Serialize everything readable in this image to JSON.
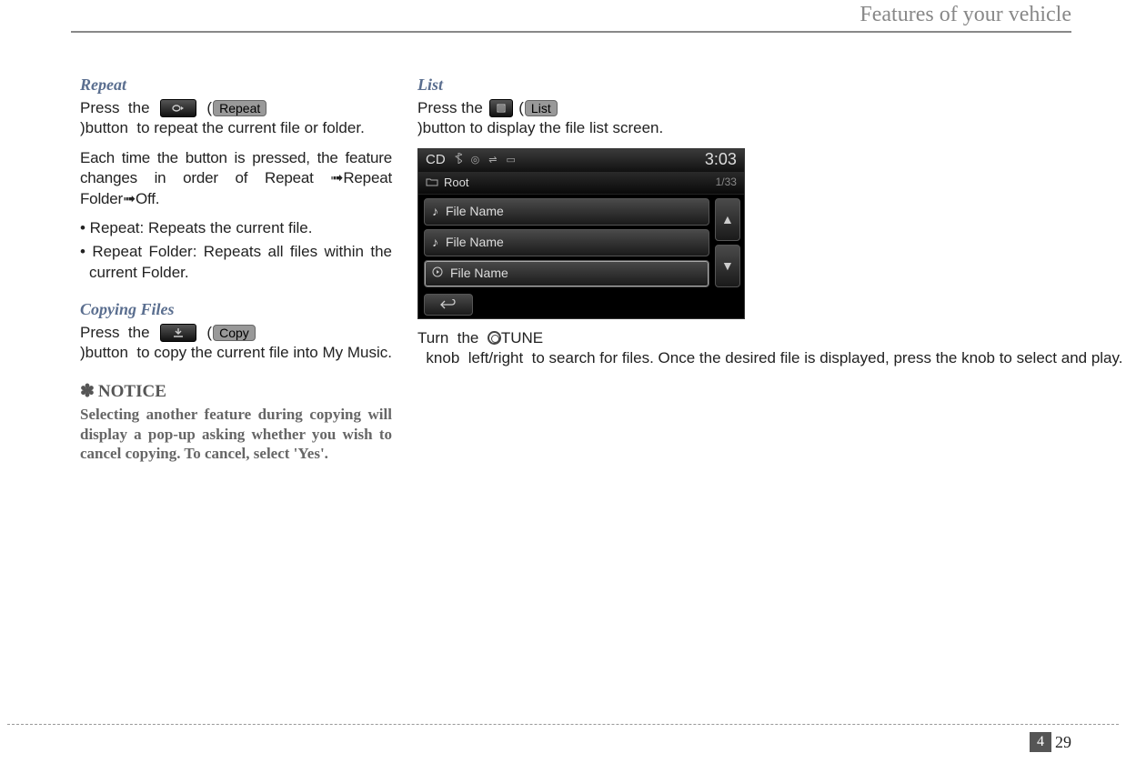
{
  "header": {
    "title": "Features of your vehicle"
  },
  "footer": {
    "chapter": "4",
    "page": "29"
  },
  "col1": {
    "repeat": {
      "title": "Repeat",
      "press_pre": "Press  the  ",
      "press_mid": "  (",
      "btn_label": "Repeat",
      "press_post": ")button  to repeat the current file or folder.",
      "para2": "Each time the button is pressed, the feature changes in order of Repeat ➟Repeat Folder➟Off.",
      "bullet1": "• Repeat: Repeats the current file.",
      "bullet2": "• Repeat Folder: Repeats all files within the current Folder."
    },
    "copying": {
      "title": "Copying Files",
      "press_pre": "Press  the  ",
      "press_mid": "  (",
      "btn_label": "Copy",
      "press_post": ")button  to copy the current file into My Music."
    },
    "notice": {
      "marker": "✽",
      "title": "NOTICE",
      "body": "Selecting another feature during copying will display a pop-up asking whether you wish to cancel copying. To cancel, select 'Yes'."
    }
  },
  "col2": {
    "list": {
      "title": "List",
      "press_pre": "Press the ",
      "press_mid": " (",
      "btn_label": "List",
      "press_post": ")button to display the file list screen."
    },
    "screenshot": {
      "top_label": "CD",
      "time": "3:03",
      "root": "Root",
      "position": "1/33",
      "item1": "File Name",
      "item2": "File Name",
      "item3": "File Name"
    },
    "tune": {
      "pre": "Turn  the  ",
      "label": "TUNE",
      "post": "  knob  left/right  to search for files. Once the desired file is displayed, press the knob to select and play."
    }
  }
}
